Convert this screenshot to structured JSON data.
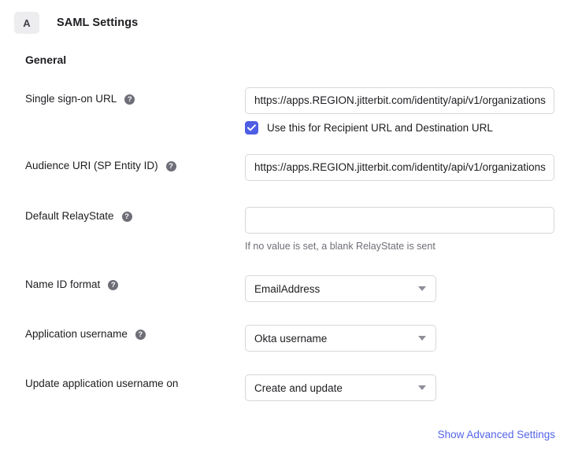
{
  "header": {
    "badge_letter": "A",
    "title": "SAML Settings"
  },
  "section": {
    "title": "General"
  },
  "fields": {
    "sso_url": {
      "label": "Single sign-on URL",
      "value": "https://apps.REGION.jitterbit.com/identity/api/v1/organizations",
      "has_help": true,
      "checkbox_label": "Use this for Recipient URL and Destination URL",
      "checkbox_checked": true
    },
    "audience_uri": {
      "label": "Audience URI (SP Entity ID)",
      "value": "https://apps.REGION.jitterbit.com/identity/api/v1/organizations",
      "has_help": true
    },
    "default_relaystate": {
      "label": "Default RelayState",
      "value": "",
      "has_help": true,
      "hint": "If no value is set, a blank RelayState is sent"
    },
    "name_id_format": {
      "label": "Name ID format",
      "value": "EmailAddress",
      "has_help": true
    },
    "application_username": {
      "label": "Application username",
      "value": "Okta username",
      "has_help": true
    },
    "update_application_username_on": {
      "label": "Update application username on",
      "value": "Create and update",
      "has_help": false
    }
  },
  "footer": {
    "advanced_link": "Show Advanced Settings"
  },
  "colors": {
    "accent": "#4e5ee4",
    "link": "#5465e8",
    "border": "#d7d7dc",
    "muted_text": "#6e6e78",
    "badge_bg": "#ededf0"
  }
}
